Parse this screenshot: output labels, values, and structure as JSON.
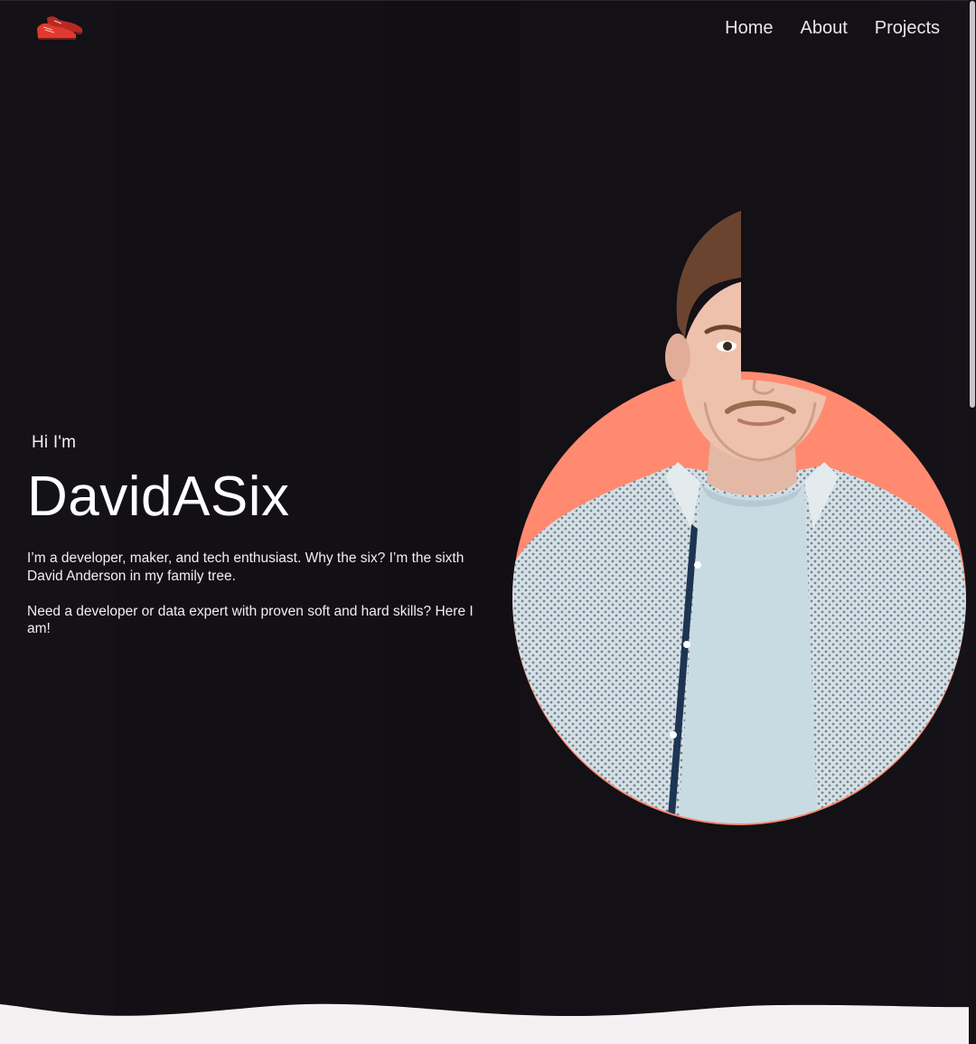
{
  "nav": {
    "logo_icon": "red-shoes-logo-icon",
    "links": [
      {
        "label": "Home"
      },
      {
        "label": "About"
      },
      {
        "label": "Projects"
      }
    ]
  },
  "hero": {
    "greeting": "Hi I'm",
    "name": "DavidASix",
    "bio_1": "I’m a developer, maker, and tech enthusiast. Why the six? I’m the sixth David Anderson in my family tree.",
    "bio_2": "Need a developer or data expert with proven soft and hard skills? Here I am!"
  },
  "colors": {
    "background": "#131016",
    "accent_circle": "#ff8a70",
    "logo_red": "#d9382c",
    "footer_light": "#f5f0f1"
  }
}
